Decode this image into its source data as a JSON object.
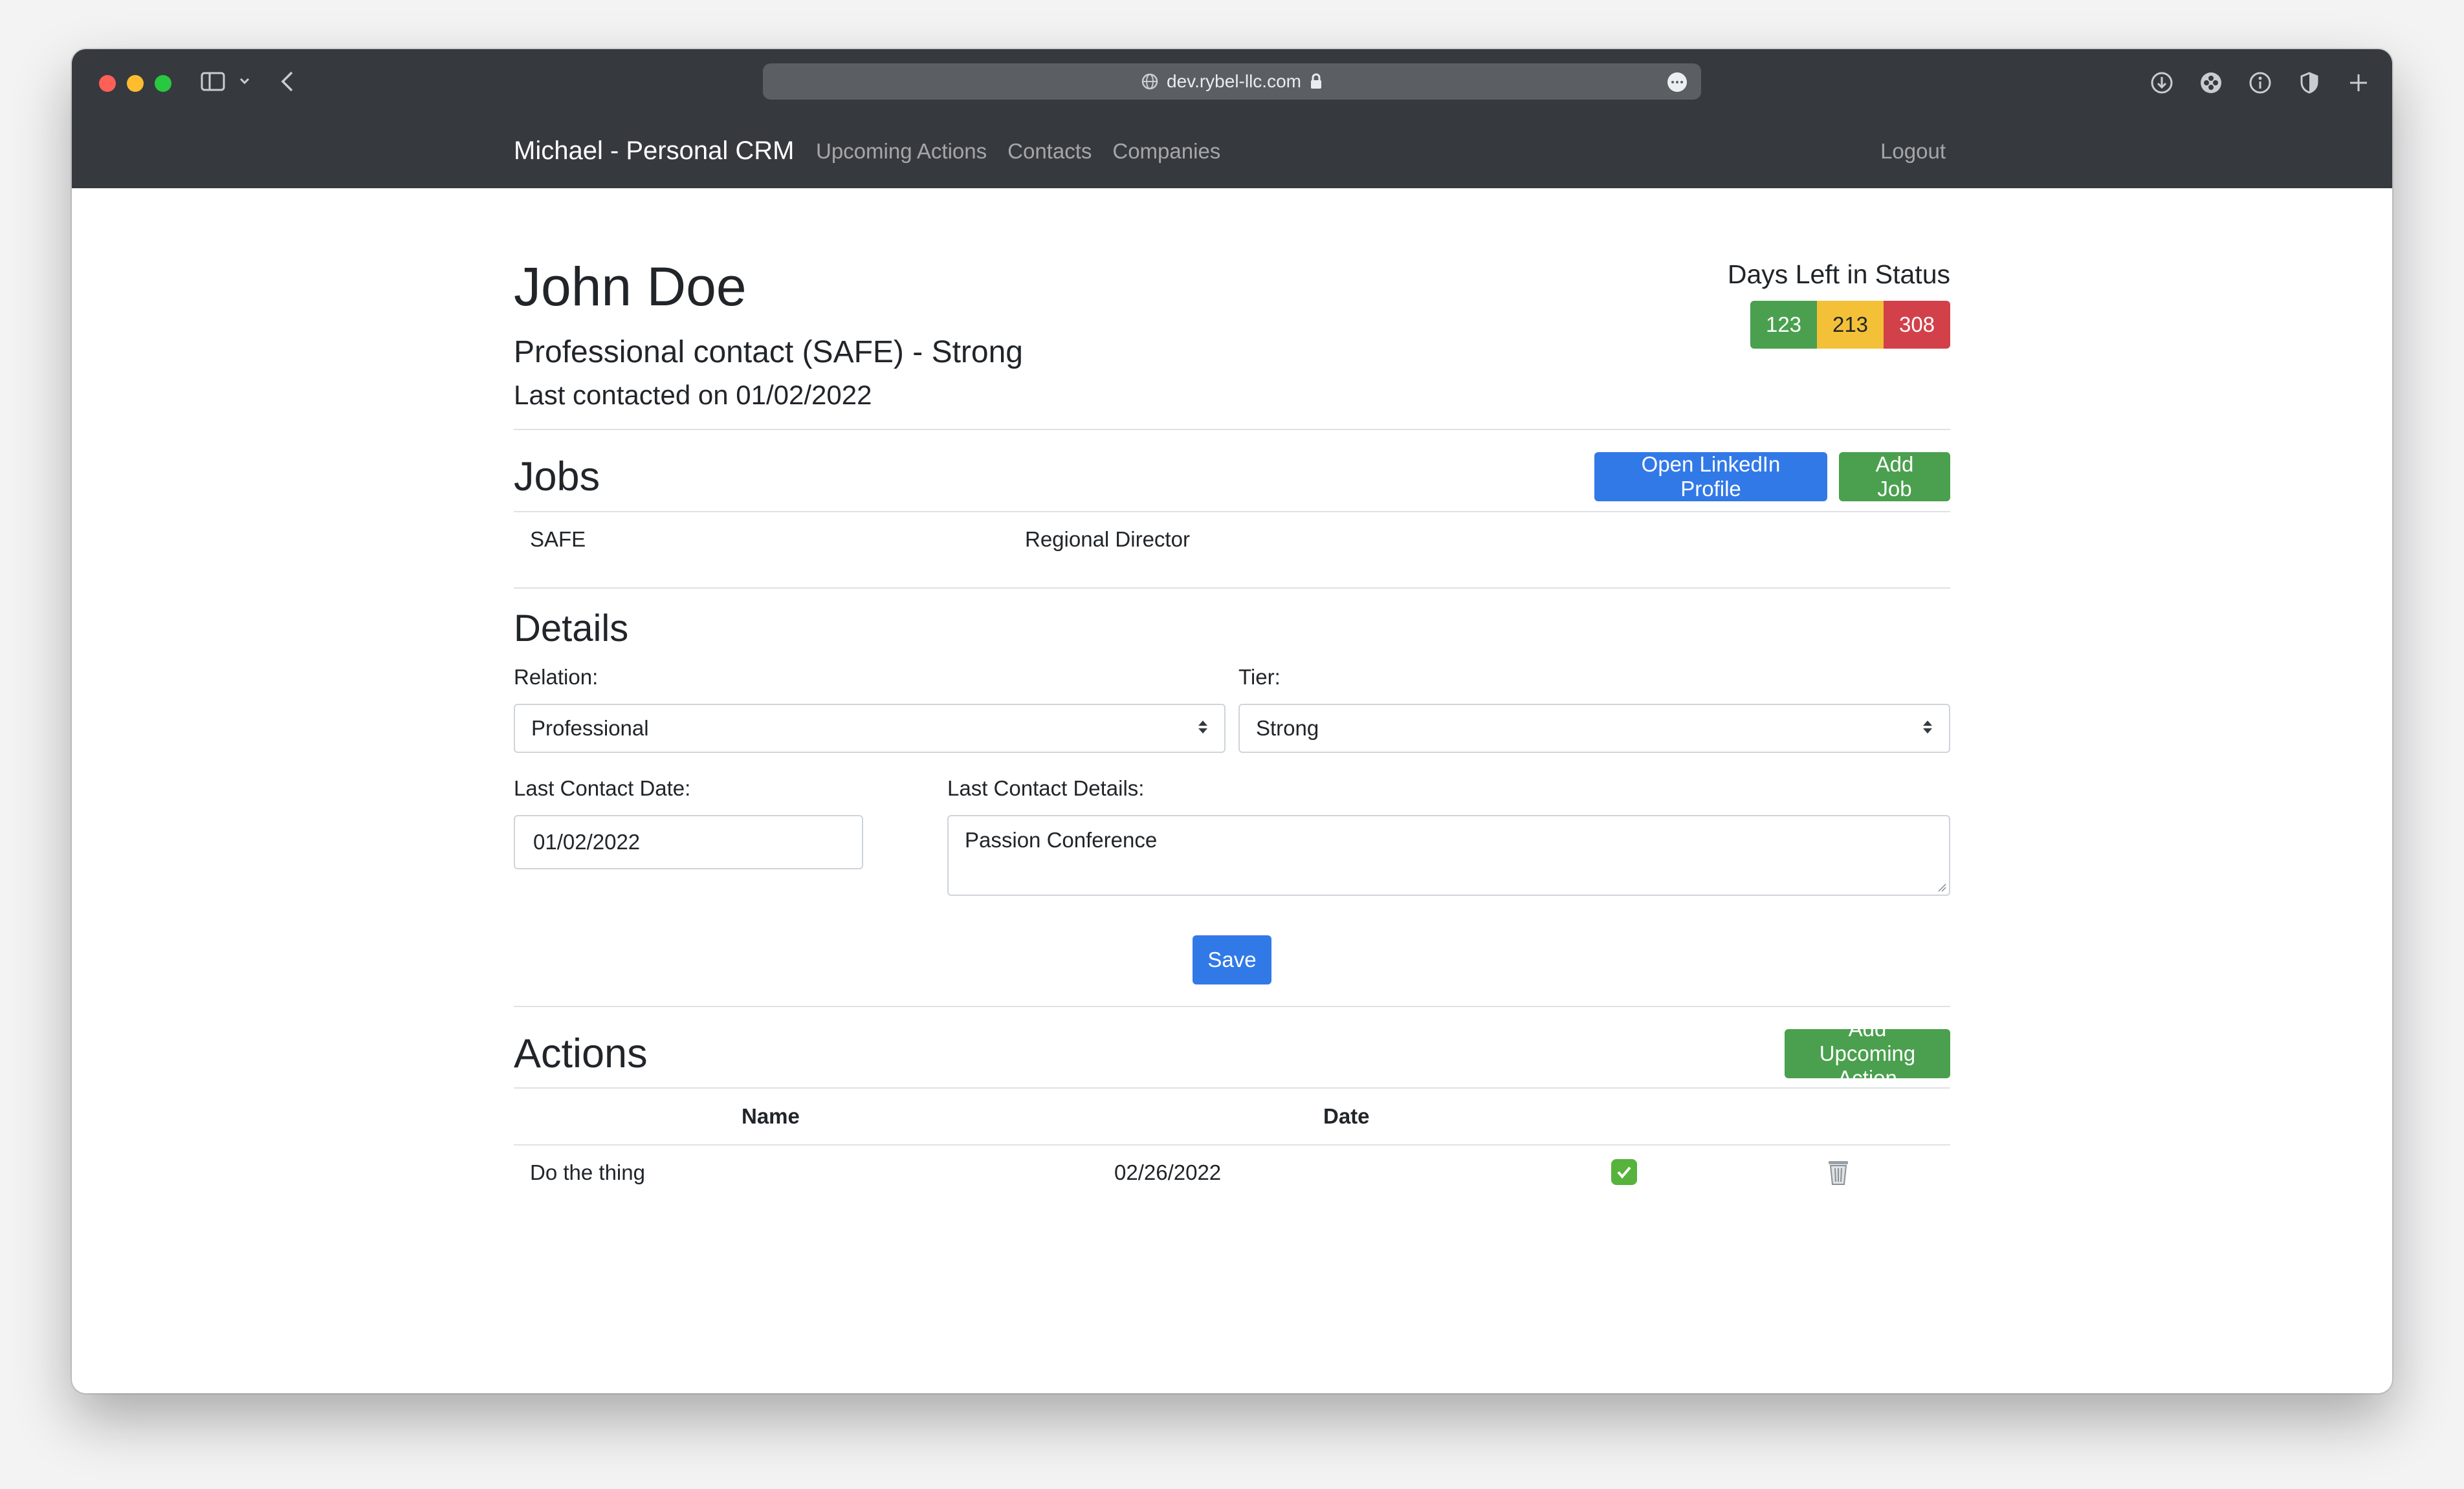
{
  "browser": {
    "url": "dev.rybel-llc.com"
  },
  "navbar": {
    "brand": "Michael - Personal CRM",
    "links": [
      "Upcoming Actions",
      "Contacts",
      "Companies"
    ],
    "logout": "Logout"
  },
  "contact": {
    "name": "John Doe",
    "subtitle": "Professional contact (SAFE) - Strong",
    "last_contacted": "Last contacted on 01/02/2022"
  },
  "days_left": {
    "title": "Days Left in Status",
    "values": [
      "123",
      "213",
      "308"
    ],
    "colors": [
      "#4aa04e",
      "#f3c038",
      "#d2414a"
    ]
  },
  "jobs": {
    "heading": "Jobs",
    "linkedin_button": "Open LinkedIn Profile",
    "add_button": "Add Job",
    "rows": [
      {
        "company": "SAFE",
        "title": "Regional Director"
      }
    ]
  },
  "details": {
    "heading": "Details",
    "relation_label": "Relation:",
    "relation_value": "Professional",
    "tier_label": "Tier:",
    "tier_value": "Strong",
    "last_contact_date_label": "Last Contact Date:",
    "last_contact_date_value": "01/02/2022",
    "last_contact_details_label": "Last Contact Details:",
    "last_contact_details_value": "Passion Conference",
    "save_button": "Save"
  },
  "actions": {
    "heading": "Actions",
    "add_button": "Add Upcoming Action",
    "columns": [
      "Name",
      "Date"
    ],
    "rows": [
      {
        "name": "Do the thing",
        "date": "02/26/2022"
      }
    ]
  },
  "colors": {
    "primary": "#3279e8",
    "success": "#4aa04e",
    "navbar": "#363a3f"
  }
}
